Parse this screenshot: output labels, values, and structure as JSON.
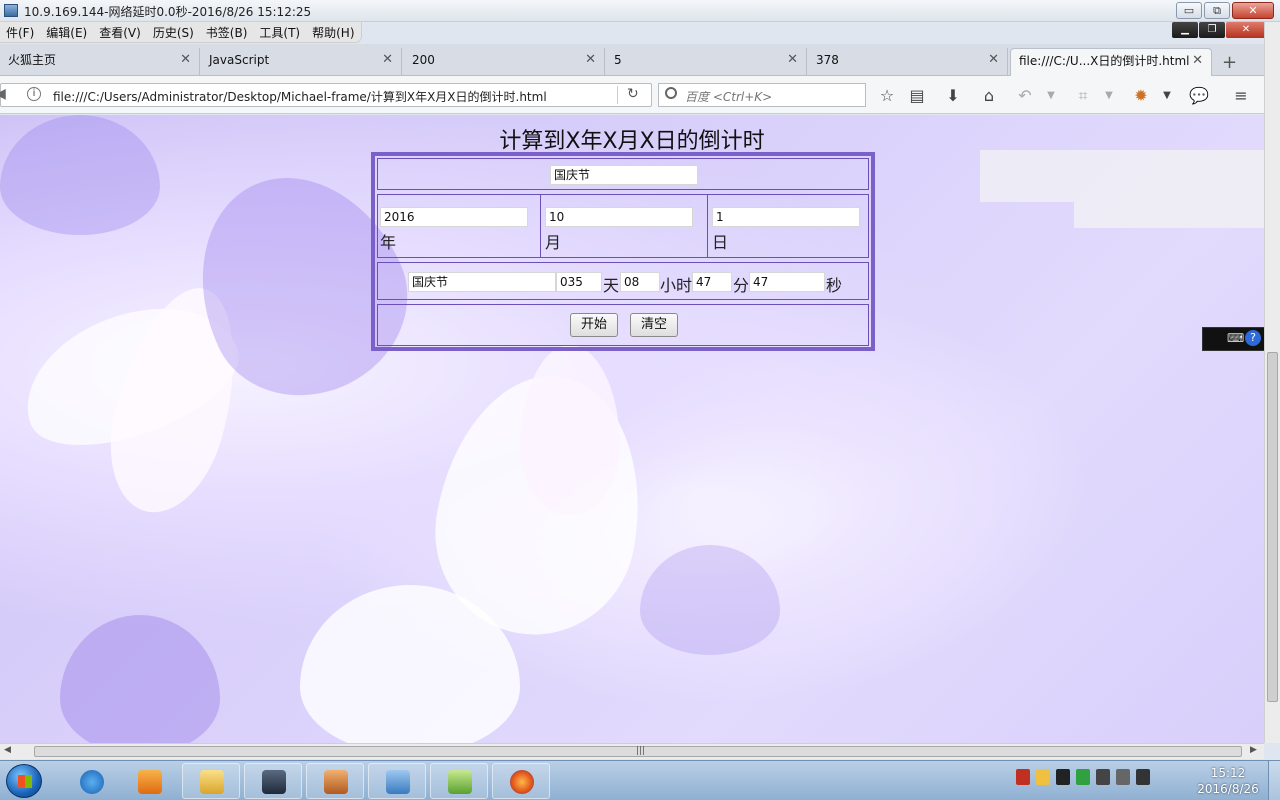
{
  "window": {
    "title": "10.9.169.144-网络延时0.0秒-2016/8/26 15:12:25",
    "min_label": "▭",
    "max_label": "⧉",
    "close_label": "✕"
  },
  "menu": [
    "件(F)",
    "编辑(E)",
    "查看(V)",
    "历史(S)",
    "书签(B)",
    "工具(T)",
    "帮助(H)"
  ],
  "tabs": [
    {
      "label": "火狐主页"
    },
    {
      "label": "JavaScript"
    },
    {
      "label": "200"
    },
    {
      "label": "5"
    },
    {
      "label": "378"
    },
    {
      "label": "file:///C:/U...X日的倒计时.html"
    }
  ],
  "tab_close": "✕",
  "new_tab": "+",
  "nav": {
    "url": "file:///C:/Users/Administrator/Desktop/Michael-frame/计算到X年X月X日的倒计时.html",
    "search_placeholder": "百度 <Ctrl+K>"
  },
  "page": {
    "heading": "计算到X年X月X日的倒计时",
    "event_name": "国庆节",
    "year": "2016",
    "month": "10",
    "day": "1",
    "year_unit": "年",
    "month_unit": "月",
    "day_unit": "日",
    "result_event": "国庆节",
    "days": "035",
    "days_unit": "天",
    "hours": "08",
    "hours_unit": "小时",
    "minutes": "47",
    "minutes_unit": "分",
    "seconds": "47",
    "seconds_unit": "秒",
    "start_button": "开始",
    "clear_button": "清空"
  },
  "taskbar": {
    "clock_time": "15:12",
    "clock_date": "2016/8/26"
  },
  "colors": {
    "form_border": "#7a60c8",
    "page_bg": "#d9d0fb"
  }
}
